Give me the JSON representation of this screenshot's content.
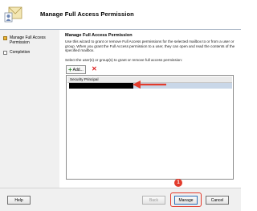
{
  "window": {
    "title": "Manage Full Access Permission"
  },
  "steps": [
    {
      "label": "Manage Full Access Permission"
    },
    {
      "label": "Completion"
    }
  ],
  "main": {
    "section_title": "Manage Full Access Permission",
    "description": "Use this wizard to grant or remove Full Access permissions for the selected mailbox to or from a user or group. When you grant the Full Access permission to a user, they can open and read the contents of the specified mailbox.",
    "select_label": "Select the user(s) or group(s) to grant or remove full access permission:",
    "toolbar": {
      "add_label": "Add..."
    },
    "list": {
      "column_header": "Security Principal"
    }
  },
  "footer": {
    "help_label": "Help",
    "back_label": "Back",
    "manage_label": "Manage",
    "cancel_label": "Cancel"
  },
  "annotations": {
    "step_number": "1"
  },
  "colors": {
    "accent": "#e23b2c",
    "active_step": "#e9b235",
    "selection": "#c9d7e8"
  }
}
